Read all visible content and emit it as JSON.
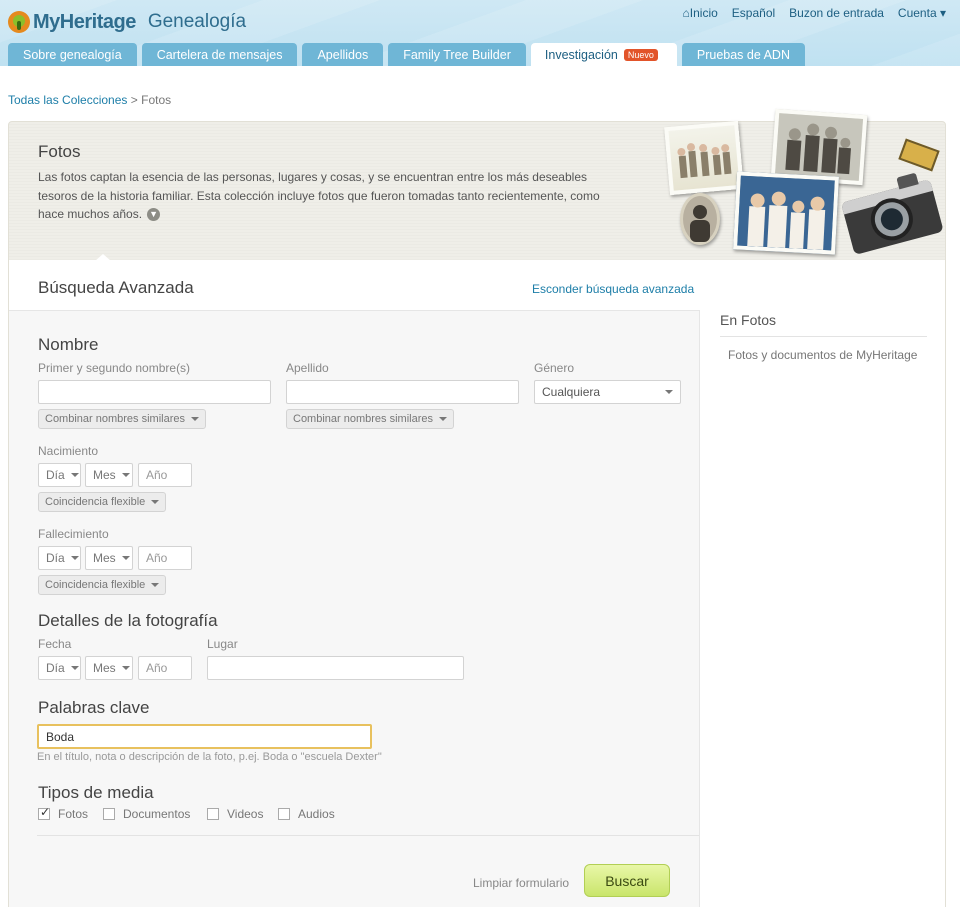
{
  "header": {
    "brand": "MyHeritage",
    "section": "Genealogía",
    "top_links": [
      "Inicio",
      "Español",
      "Buzon de entrada",
      "Cuenta"
    ],
    "tabs": [
      {
        "label": "Sobre genealogía"
      },
      {
        "label": "Cartelera de mensajes"
      },
      {
        "label": "Apellidos"
      },
      {
        "label": "Family Tree Builder"
      },
      {
        "label": "Investigación",
        "badge": "Nuevo"
      },
      {
        "label": "Pruebas de ADN"
      }
    ]
  },
  "breadcrumb": {
    "link": "Todas las Colecciones",
    "separator": ">",
    "current": "Fotos"
  },
  "banner": {
    "title": "Fotos",
    "description": "Las fotos captan la esencia de las personas, lugares y cosas, y se encuentran entre los más deseables tesoros de la historia familiar. Esta colección incluye fotos que fueron tomadas tanto recientemente, como hace muchos años."
  },
  "search": {
    "title": "Búsqueda Avanzada",
    "hide_link": "Esconder búsqueda avanzada",
    "name": {
      "heading": "Nombre",
      "first_label": "Primer y segundo nombre(s)",
      "last_label": "Apellido",
      "gender_label": "Género",
      "gender_value": "Cualquiera",
      "similar": "Combinar nombres similares"
    },
    "birth": {
      "label": "Nacimiento",
      "day": "Día",
      "month": "Mes",
      "year": "Año",
      "flex": "Coincidencia flexible"
    },
    "death": {
      "label": "Fallecimiento",
      "day": "Día",
      "month": "Mes",
      "year": "Año",
      "flex": "Coincidencia flexible"
    },
    "photo": {
      "heading": "Detalles de la fotografía",
      "date_label": "Fecha",
      "place_label": "Lugar",
      "day": "Día",
      "month": "Mes",
      "year": "Año"
    },
    "keywords": {
      "heading": "Palabras clave",
      "value": "Boda",
      "hint": "En el título, nota o descripción de la foto, p.ej. Boda o \"escuela Dexter\""
    },
    "media": {
      "heading": "Tipos de media",
      "items": [
        {
          "label": "Fotos",
          "checked": true
        },
        {
          "label": "Documentos",
          "checked": false
        },
        {
          "label": "Videos",
          "checked": false
        },
        {
          "label": "Audios",
          "checked": false
        }
      ]
    },
    "clear": "Limpiar formulario",
    "submit": "Buscar"
  },
  "sidebar": {
    "title": "En Fotos",
    "link": "Fotos y documentos de MyHeritage"
  },
  "colors": {
    "accent": "#6fb6d6",
    "link": "#1d7ea8",
    "badge": "#e2542a",
    "button": "#c9e56b"
  }
}
